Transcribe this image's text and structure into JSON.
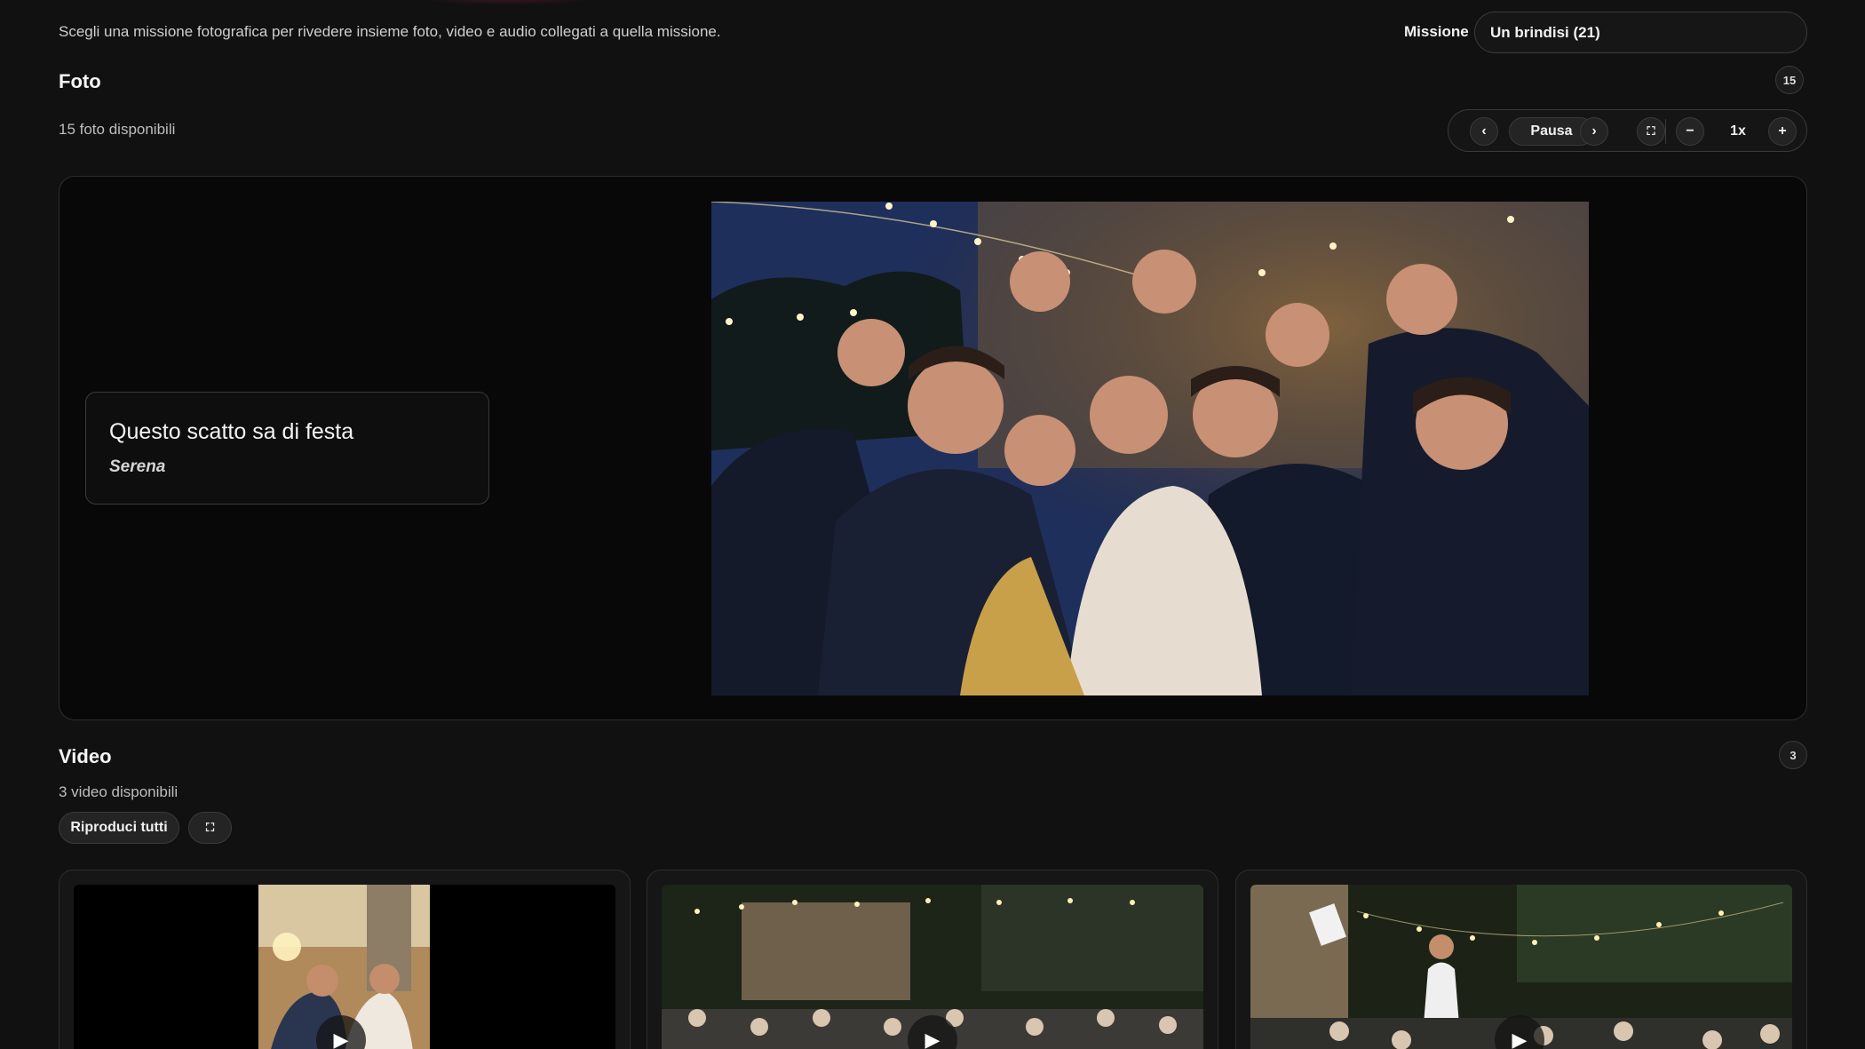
{
  "intro_text": "Scegli una missione fotografica per rivedere insieme foto, video e audio collegati a quella missione.",
  "mission": {
    "label": "Missione",
    "selected": "Un brindisi (21)"
  },
  "photos": {
    "title": "Foto",
    "count_badge": "15",
    "available_text": "15 foto disponibili",
    "player": {
      "prev": "‹",
      "pause": "Pausa",
      "next": "›",
      "fullscreen": "⛶",
      "minus": "−",
      "speed": "1x",
      "plus": "+"
    },
    "caption": {
      "text": "Questo scatto sa di festa",
      "author": "Serena"
    }
  },
  "videos": {
    "title": "Video",
    "count_badge": "3",
    "available_text": "3 video disponibili",
    "play_all": "Riproduci tutti",
    "fullscreen": "⛶",
    "play_glyph": "▶"
  },
  "colors": {
    "background": "#111111",
    "panel": "#080808",
    "border": "#3a3a3a",
    "button": "#242424"
  }
}
